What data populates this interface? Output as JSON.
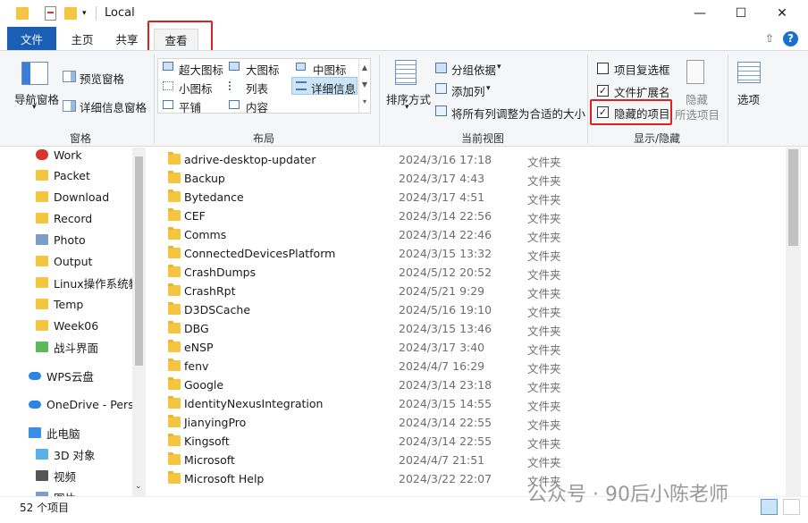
{
  "window": {
    "title": "Local",
    "minimize": "—",
    "maximize": "☐",
    "close": "✕"
  },
  "tabs": {
    "file": "文件",
    "home": "主页",
    "share": "共享",
    "view": "查看"
  },
  "ribbon": {
    "panes": {
      "nav_pane": "导航窗格",
      "preview_pane": "预览窗格",
      "details_pane": "详细信息窗格",
      "group_label": "窗格"
    },
    "layout": {
      "extra_large": "超大图标",
      "large": "大图标",
      "medium": "中图标",
      "small": "小图标",
      "list": "列表",
      "details": "详细信息",
      "tiles": "平铺",
      "content": "内容",
      "group_label": "布局"
    },
    "current_view": {
      "sort_by": "排序方式",
      "group_by": "分组依据",
      "add_column": "添加列",
      "size_all_columns": "将所有列调整为合适的大小",
      "group_label": "当前视图"
    },
    "show_hide": {
      "item_checkboxes": "项目复选框",
      "item_checkboxes_checked": false,
      "file_extensions": "文件扩展名",
      "file_extensions_checked": true,
      "hidden_items": "隐藏的项目",
      "hidden_items_checked": true,
      "hide_selected_1": "隐藏",
      "hide_selected_2": "所选项目",
      "group_label": "显示/隐藏"
    },
    "options": "选项"
  },
  "nav": {
    "items": [
      {
        "label": "Work",
        "icon": "warning-folder-icon",
        "pinned": true
      },
      {
        "label": "Packet",
        "icon": "folder-icon",
        "pinned": true
      },
      {
        "label": "Download",
        "icon": "folder-icon",
        "pinned": true
      },
      {
        "label": "Record",
        "icon": "folder-icon",
        "pinned": true
      },
      {
        "label": "Photo",
        "icon": "image-folder-icon",
        "pinned": true
      },
      {
        "label": "Output",
        "icon": "folder-icon",
        "pinned": true
      },
      {
        "label": "Linux操作系统教",
        "icon": "folder-icon",
        "pinned": false
      },
      {
        "label": "Temp",
        "icon": "folder-icon",
        "pinned": false
      },
      {
        "label": "Week06",
        "icon": "folder-icon",
        "pinned": false
      },
      {
        "label": "战斗界面",
        "icon": "green-check-folder-icon",
        "pinned": false
      },
      {
        "label": "WPS云盘",
        "icon": "cloud-icon",
        "pinned": false
      },
      {
        "label": "OneDrive - Perso",
        "icon": "onedrive-icon",
        "pinned": false
      },
      {
        "label": "此电脑",
        "icon": "computer-icon",
        "pinned": false
      },
      {
        "label": "3D 对象",
        "icon": "cube-icon",
        "pinned": false
      },
      {
        "label": "视频",
        "icon": "video-icon",
        "pinned": false
      },
      {
        "label": "图片",
        "icon": "picture-icon",
        "pinned": false
      }
    ]
  },
  "files": [
    {
      "name": "adrive-desktop-updater",
      "date": "2024/3/16 17:18",
      "type": "文件夹"
    },
    {
      "name": "Backup",
      "date": "2024/3/17 4:43",
      "type": "文件夹"
    },
    {
      "name": "Bytedance",
      "date": "2024/3/17 4:51",
      "type": "文件夹"
    },
    {
      "name": "CEF",
      "date": "2024/3/14 22:56",
      "type": "文件夹"
    },
    {
      "name": "Comms",
      "date": "2024/3/14 22:46",
      "type": "文件夹"
    },
    {
      "name": "ConnectedDevicesPlatform",
      "date": "2024/3/15 13:32",
      "type": "文件夹"
    },
    {
      "name": "CrashDumps",
      "date": "2024/5/12 20:52",
      "type": "文件夹"
    },
    {
      "name": "CrashRpt",
      "date": "2024/5/21 9:29",
      "type": "文件夹"
    },
    {
      "name": "D3DSCache",
      "date": "2024/5/16 19:10",
      "type": "文件夹"
    },
    {
      "name": "DBG",
      "date": "2024/3/15 13:46",
      "type": "文件夹"
    },
    {
      "name": "eNSP",
      "date": "2024/3/17 3:40",
      "type": "文件夹"
    },
    {
      "name": "fenv",
      "date": "2024/4/7 16:29",
      "type": "文件夹"
    },
    {
      "name": "Google",
      "date": "2024/3/14 23:18",
      "type": "文件夹"
    },
    {
      "name": "IdentityNexusIntegration",
      "date": "2024/3/15 14:55",
      "type": "文件夹"
    },
    {
      "name": "JianyingPro",
      "date": "2024/3/14 22:55",
      "type": "文件夹"
    },
    {
      "name": "Kingsoft",
      "date": "2024/3/14 22:55",
      "type": "文件夹"
    },
    {
      "name": "Microsoft",
      "date": "2024/4/7 21:51",
      "type": "文件夹"
    },
    {
      "name": "Microsoft Help",
      "date": "2024/3/22 22:07",
      "type": "文件夹"
    }
  ],
  "status": {
    "count": "52 个项目"
  },
  "watermark": "公众号 · 90后小陈老师",
  "colors": {
    "accent": "#1a5fb4",
    "highlight": "#e02020",
    "folder": "#f5c542"
  }
}
